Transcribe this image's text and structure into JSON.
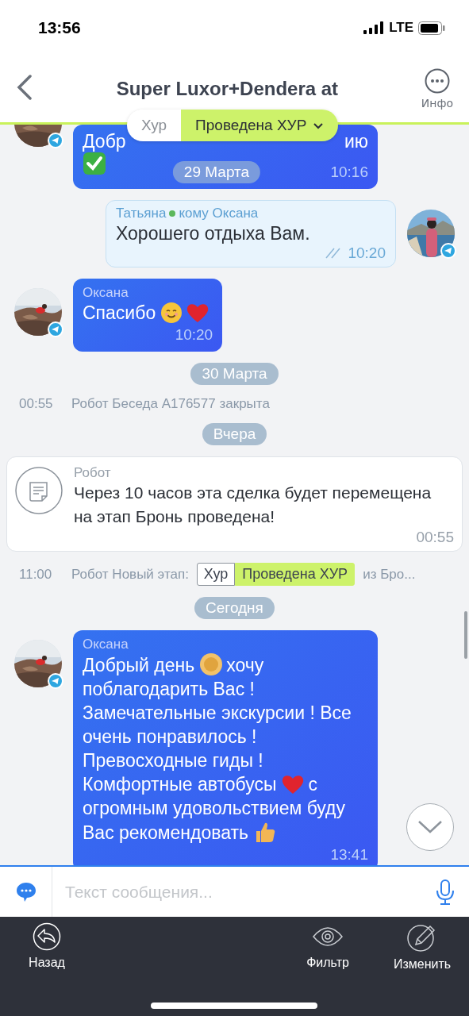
{
  "status_bar": {
    "time": "13:56",
    "network": "LTE"
  },
  "header": {
    "title": "Super Luxor+Dendera at",
    "info_label": "Инфо"
  },
  "stage_pill": [
    {
      "label": "Хур",
      "selected": false
    },
    {
      "label": "Проведена ХУР",
      "selected": true
    }
  ],
  "feed": [
    {
      "kind": "in",
      "head_fragments": [
        "Добр",
        "ию"
      ],
      "lines": [
        [
          {
            "kind": "check"
          }
        ]
      ],
      "overlay_date": "29 Марта",
      "time": "10:16"
    },
    {
      "kind": "out",
      "sender": "Татьяна",
      "online": true,
      "recipient": "кому Оксана",
      "text": "Хорошего отдыха Вам.",
      "read": true,
      "time": "10:20"
    },
    {
      "kind": "in",
      "sender": "Оксана",
      "lines": [
        [
          {
            "kind": "text",
            "text": "Спасибо"
          },
          {
            "kind": "smile"
          },
          {
            "kind": "heart"
          }
        ]
      ],
      "time": "10:20"
    },
    {
      "kind": "date",
      "text": "30 Марта"
    },
    {
      "kind": "system",
      "time": "00:55",
      "text": "Робот Беседа A176577 закрыта"
    },
    {
      "kind": "date",
      "text": "Вчера"
    },
    {
      "kind": "robot",
      "sender": "Робот",
      "text": "Через 10 часов эта сделка будет перемещена на этап Бронь проведена!",
      "time": "00:55"
    },
    {
      "kind": "system",
      "time": "11:00",
      "text": "Робот Новый этап:",
      "tags": [
        {
          "label": "Хур",
          "selected": false
        },
        {
          "label": "Проведена ХУР",
          "selected": true
        }
      ],
      "tail": "из Бро..."
    },
    {
      "kind": "date",
      "text": "Сегодня"
    },
    {
      "kind": "in",
      "sender": "Оксана",
      "lines": [
        [
          {
            "kind": "text",
            "text": "Добрый день"
          },
          {
            "kind": "sun"
          },
          {
            "kind": "text",
            "text": "хочу"
          }
        ],
        [
          {
            "kind": "text",
            "text": "поблагодарить Вас !"
          }
        ],
        [
          {
            "kind": "text",
            "text": "Замечательные экскурсии ! Все"
          }
        ],
        [
          {
            "kind": "text",
            "text": "очень понравилось !"
          }
        ],
        [
          {
            "kind": "text",
            "text": "Превосходные гиды !"
          }
        ],
        [
          {
            "kind": "text",
            "text": "Комфортные автобусы"
          },
          {
            "kind": "heart"
          },
          {
            "kind": "text",
            "text": "с"
          }
        ],
        [
          {
            "kind": "text",
            "text": "огромным удовольствием буду"
          }
        ],
        [
          {
            "kind": "text",
            "text": "Вас рекомендовать"
          },
          {
            "kind": "thumb"
          }
        ]
      ],
      "time": "13:41"
    }
  ],
  "composer": {
    "placeholder": "Текст сообщения..."
  },
  "toolbar": [
    {
      "kind": "back",
      "label": "Назад"
    },
    {
      "kind": "eye",
      "label": "Фильтр"
    },
    {
      "kind": "edit",
      "label": "Изменить"
    }
  ]
}
